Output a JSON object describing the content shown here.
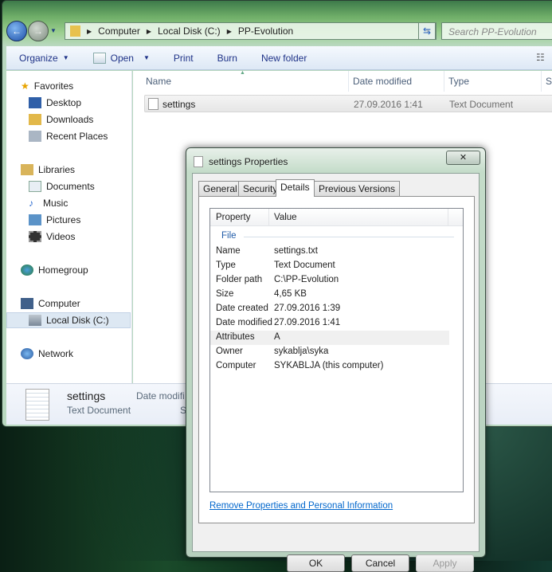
{
  "explorer": {
    "breadcrumb": [
      "Computer",
      "Local Disk (C:)",
      "PP-Evolution"
    ],
    "search_placeholder": "Search PP-Evolution",
    "toolbar": {
      "organize": "Organize",
      "open": "Open",
      "print": "Print",
      "burn": "Burn",
      "new_folder": "New folder"
    },
    "nav": {
      "favorites": "Favorites",
      "desktop": "Desktop",
      "downloads": "Downloads",
      "recent": "Recent Places",
      "libraries": "Libraries",
      "documents": "Documents",
      "music": "Music",
      "pictures": "Pictures",
      "videos": "Videos",
      "homegroup": "Homegroup",
      "computer": "Computer",
      "local_disk": "Local Disk (C:)",
      "network": "Network"
    },
    "columns": {
      "name": "Name",
      "date": "Date modified",
      "type": "Type",
      "size": "Siz"
    },
    "files": [
      {
        "name": "settings",
        "date": "27.09.2016 1:41",
        "type": "Text Document"
      }
    ],
    "details": {
      "name": "settings",
      "type": "Text Document",
      "date_label": "Date modifi",
      "size_label": "Si"
    }
  },
  "dialog": {
    "title": "settings Properties",
    "close": "✕",
    "tabs": [
      "General",
      "Security",
      "Details",
      "Previous Versions"
    ],
    "header": {
      "property": "Property",
      "value": "Value"
    },
    "group": "File",
    "rows": [
      {
        "k": "Name",
        "v": "settings.txt"
      },
      {
        "k": "Type",
        "v": "Text Document"
      },
      {
        "k": "Folder path",
        "v": "C:\\PP-Evolution"
      },
      {
        "k": "Size",
        "v": "4,65 KB"
      },
      {
        "k": "Date created",
        "v": "27.09.2016 1:39"
      },
      {
        "k": "Date modified",
        "v": "27.09.2016 1:41"
      },
      {
        "k": "Attributes",
        "v": "A"
      },
      {
        "k": "Owner",
        "v": "sykablja\\syka"
      },
      {
        "k": "Computer",
        "v": "SYKABLJA (this computer)"
      }
    ],
    "link": "Remove Properties and Personal Information",
    "ok": "OK",
    "cancel": "Cancel",
    "apply": "Apply"
  }
}
